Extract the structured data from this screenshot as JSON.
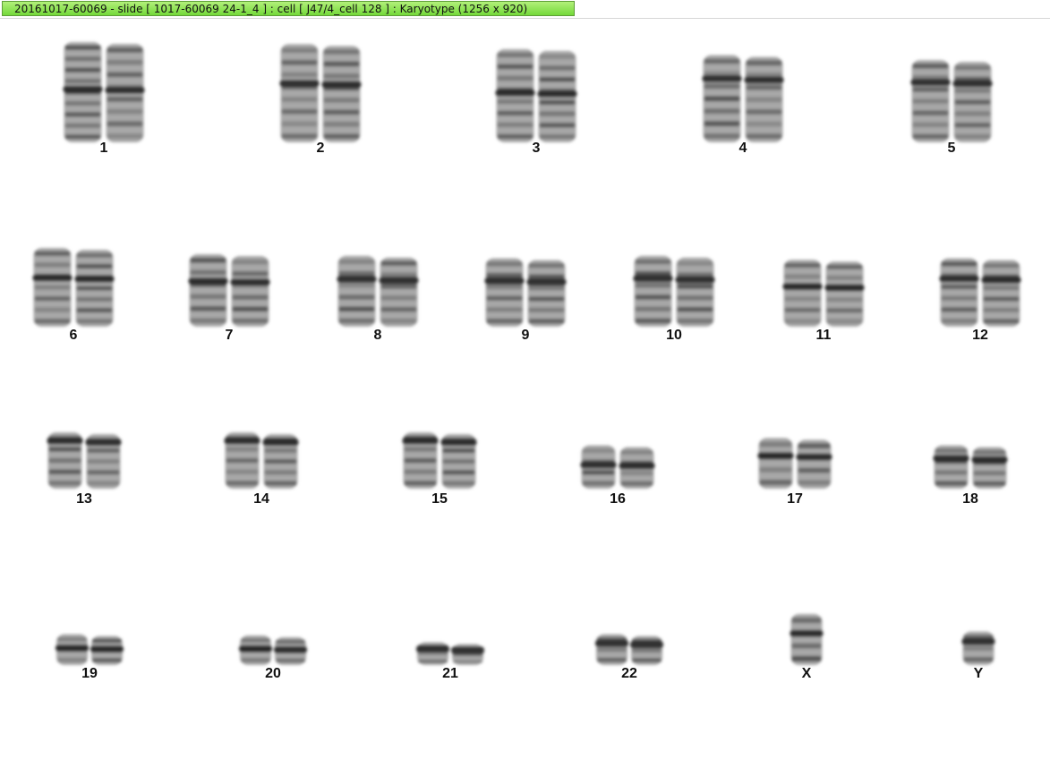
{
  "window": {
    "title": "20161017-60069 - slide [ 1017-60069 24-1_4 ] : cell [ J47/4_cell 128 ] : Karyotype  (1256 x 920)"
  },
  "colors": {
    "title_bar_gradient_top": "#b2f07a",
    "title_bar_gradient_bottom": "#74d93a",
    "background": "#ffffff",
    "chromosome_light": "#a8a8a8",
    "chromosome_dark": "#1e1e1e"
  },
  "karyotype": {
    "rows": [
      {
        "chromosomes": [
          {
            "label": "1",
            "count": 2,
            "size": 1.0,
            "centromere": 0.47
          },
          {
            "label": "2",
            "count": 2,
            "size": 0.98,
            "centromere": 0.4
          },
          {
            "label": "3",
            "count": 2,
            "size": 0.93,
            "centromere": 0.47
          },
          {
            "label": "4",
            "count": 2,
            "size": 0.87,
            "centromere": 0.27
          },
          {
            "label": "5",
            "count": 2,
            "size": 0.82,
            "centromere": 0.27
          }
        ]
      },
      {
        "chromosomes": [
          {
            "label": "6",
            "count": 2,
            "size": 1.0,
            "centromere": 0.38
          },
          {
            "label": "7",
            "count": 2,
            "size": 0.92,
            "centromere": 0.37
          },
          {
            "label": "8",
            "count": 2,
            "size": 0.9,
            "centromere": 0.33
          },
          {
            "label": "9",
            "count": 2,
            "size": 0.87,
            "centromere": 0.33
          },
          {
            "label": "10",
            "count": 2,
            "size": 0.9,
            "centromere": 0.32
          },
          {
            "label": "11",
            "count": 2,
            "size": 0.85,
            "centromere": 0.4
          },
          {
            "label": "12",
            "count": 2,
            "size": 0.87,
            "centromere": 0.3
          }
        ]
      },
      {
        "chromosomes": [
          {
            "label": "13",
            "count": 2,
            "size": 1.0,
            "centromere": 0.15
          },
          {
            "label": "14",
            "count": 2,
            "size": 1.0,
            "centromere": 0.15
          },
          {
            "label": "15",
            "count": 2,
            "size": 1.0,
            "centromere": 0.15
          },
          {
            "label": "16",
            "count": 2,
            "size": 0.77,
            "centromere": 0.45
          },
          {
            "label": "17",
            "count": 2,
            "size": 0.9,
            "centromere": 0.35
          },
          {
            "label": "18",
            "count": 2,
            "size": 0.77,
            "centromere": 0.3
          }
        ]
      },
      {
        "chromosomes": [
          {
            "label": "19",
            "count": 2,
            "size": 0.72,
            "centromere": 0.45
          },
          {
            "label": "20",
            "count": 2,
            "size": 0.69,
            "centromere": 0.45
          },
          {
            "label": "21",
            "count": 2,
            "size": 0.53,
            "centromere": 0.3
          },
          {
            "label": "22",
            "count": 2,
            "size": 0.72,
            "centromere": 0.3
          },
          {
            "label": "X",
            "count": 1,
            "size": 1.19,
            "centromere": 0.38
          },
          {
            "label": "Y",
            "count": 1,
            "size": 0.78,
            "centromere": 0.3
          }
        ]
      }
    ]
  }
}
